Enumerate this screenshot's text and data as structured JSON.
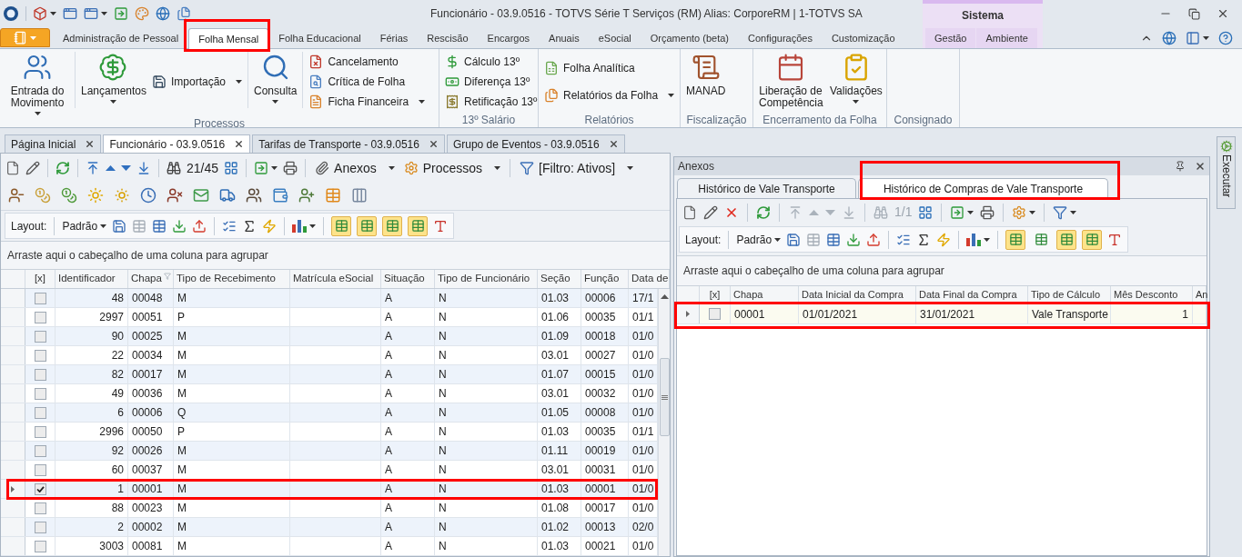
{
  "window": {
    "title": "Funcionário - 03.9.0516 - TOTVS Série T Serviços (RM) Alias: CorporeRM | 1-TOTVS SA"
  },
  "ribbon": {
    "context_group": "Sistema",
    "tabs": [
      {
        "label": "Administração de Pessoal",
        "selected": false,
        "highlighted": false,
        "contextual": false
      },
      {
        "label": "Folha Mensal",
        "selected": true,
        "highlighted": true,
        "contextual": false
      },
      {
        "label": "Folha Educacional",
        "selected": false,
        "highlighted": false,
        "contextual": false
      },
      {
        "label": "Férias",
        "selected": false,
        "highlighted": false,
        "contextual": false
      },
      {
        "label": "Rescisão",
        "selected": false,
        "highlighted": false,
        "contextual": false
      },
      {
        "label": "Encargos",
        "selected": false,
        "highlighted": false,
        "contextual": false
      },
      {
        "label": "Anuais",
        "selected": false,
        "highlighted": false,
        "contextual": false
      },
      {
        "label": "eSocial",
        "selected": false,
        "highlighted": false,
        "contextual": false
      },
      {
        "label": "Orçamento (beta)",
        "selected": false,
        "highlighted": false,
        "contextual": false
      },
      {
        "label": "Configurações",
        "selected": false,
        "highlighted": false,
        "contextual": false
      },
      {
        "label": "Customização",
        "selected": false,
        "highlighted": false,
        "contextual": false
      },
      {
        "label": "Gestão",
        "selected": false,
        "highlighted": false,
        "contextual": true
      },
      {
        "label": "Ambiente",
        "selected": false,
        "highlighted": false,
        "contextual": true
      }
    ],
    "groups": [
      {
        "label": "Processos",
        "items": [
          {
            "kind": "large",
            "label": "Entrada do Movimento",
            "dropdown": true
          },
          {
            "kind": "large",
            "label": "Lançamentos",
            "dropdown": true
          },
          {
            "kind": "stack",
            "buttons": [
              {
                "label": "Importação",
                "dropdown": true
              }
            ]
          },
          {
            "kind": "large",
            "label": "Consulta",
            "dropdown": true
          },
          {
            "kind": "stack",
            "buttons": [
              {
                "label": "Cancelamento",
                "dropdown": false
              },
              {
                "label": "Crítica de Folha",
                "dropdown": false
              },
              {
                "label": "Ficha Financeira",
                "dropdown": true
              }
            ]
          }
        ]
      },
      {
        "label": "13º Salário",
        "items": [
          {
            "kind": "stack",
            "buttons": [
              {
                "label": "Cálculo 13º",
                "dropdown": false
              },
              {
                "label": "Diferença 13º",
                "dropdown": false
              },
              {
                "label": "Retificação 13º",
                "dropdown": false
              }
            ]
          }
        ]
      },
      {
        "label": "Relatórios",
        "items": [
          {
            "kind": "stack",
            "buttons": [
              {
                "label": "Folha Analítica",
                "dropdown": false
              },
              {
                "label": "Relatórios da Folha",
                "dropdown": true
              }
            ]
          }
        ]
      },
      {
        "label": "Fiscalização",
        "items": [
          {
            "kind": "large",
            "label": "MANAD",
            "dropdown": false
          }
        ]
      },
      {
        "label": "Encerramento da Folha",
        "items": [
          {
            "kind": "large",
            "label": "Liberação de Competência",
            "dropdown": false
          },
          {
            "kind": "large",
            "label": "Validações",
            "dropdown": true
          }
        ]
      },
      {
        "label": "Consignado"
      }
    ]
  },
  "document_tabs": [
    {
      "label": "Página Inicial",
      "selected": false
    },
    {
      "label": "Funcionário - 03.9.0516",
      "selected": true
    },
    {
      "label": "Tarifas de Transporte - 03.9.0516",
      "selected": false
    },
    {
      "label": "Grupo de Eventos - 03.9.0516",
      "selected": false
    }
  ],
  "employee_grid": {
    "toolbar": {
      "record_counter": "21/45",
      "navigation_disabled": false,
      "menus": [
        "Anexos",
        "Processos",
        "[Filtro: Ativos]"
      ]
    },
    "layout_bar": {
      "label": "Layout:",
      "preset": "Padrão",
      "toggles": [
        {
          "on": true
        },
        {
          "on": true
        },
        {
          "on": true
        },
        {
          "on": true
        }
      ]
    },
    "group_hint": "Arraste aqui o cabeçalho de uma coluna para agrupar",
    "checkbox_column": "[x]",
    "columns": [
      {
        "label": "Identificador",
        "filtered": false
      },
      {
        "label": "Chapa",
        "filtered": true
      },
      {
        "label": "Tipo de Recebimento",
        "filtered": false
      },
      {
        "label": "Matrícula eSocial",
        "filtered": false
      },
      {
        "label": "Situação",
        "filtered": false
      },
      {
        "label": "Tipo de Funcionário",
        "filtered": false
      },
      {
        "label": "Seção",
        "filtered": false
      },
      {
        "label": "Função",
        "filtered": false
      },
      {
        "label": "Data de",
        "filtered": false
      }
    ],
    "rows": [
      {
        "checked": false,
        "current": false,
        "highlighted": false,
        "cells": [
          "48",
          "00048",
          "M",
          null,
          "A",
          "N",
          "01.03",
          "00006",
          "17/1"
        ]
      },
      {
        "checked": false,
        "current": false,
        "highlighted": false,
        "cells": [
          "2997",
          "00051",
          "P",
          null,
          "A",
          "N",
          "01.06",
          "00035",
          "01/1"
        ]
      },
      {
        "checked": false,
        "current": false,
        "highlighted": false,
        "cells": [
          "90",
          "00025",
          "M",
          null,
          "A",
          "N",
          "01.09",
          "00018",
          "01/0"
        ]
      },
      {
        "checked": false,
        "current": false,
        "highlighted": false,
        "cells": [
          "22",
          "00034",
          "M",
          null,
          "A",
          "N",
          "03.01",
          "00027",
          "01/0"
        ]
      },
      {
        "checked": false,
        "current": false,
        "highlighted": false,
        "cells": [
          "82",
          "00017",
          "M",
          null,
          "A",
          "N",
          "01.07",
          "00015",
          "01/0"
        ]
      },
      {
        "checked": false,
        "current": false,
        "highlighted": false,
        "cells": [
          "49",
          "00036",
          "M",
          null,
          "A",
          "N",
          "03.01",
          "00032",
          "01/0"
        ]
      },
      {
        "checked": false,
        "current": false,
        "highlighted": false,
        "cells": [
          "6",
          "00006",
          "Q",
          null,
          "A",
          "N",
          "01.05",
          "00008",
          "01/0"
        ]
      },
      {
        "checked": false,
        "current": false,
        "highlighted": false,
        "cells": [
          "2996",
          "00050",
          "P",
          null,
          "A",
          "N",
          "01.03",
          "00035",
          "01/1"
        ]
      },
      {
        "checked": false,
        "current": false,
        "highlighted": false,
        "cells": [
          "92",
          "00026",
          "M",
          null,
          "A",
          "N",
          "01.11",
          "00019",
          "01/0"
        ]
      },
      {
        "checked": false,
        "current": false,
        "highlighted": false,
        "cells": [
          "60",
          "00037",
          "M",
          null,
          "A",
          "N",
          "03.01",
          "00031",
          "01/0"
        ]
      },
      {
        "checked": true,
        "current": true,
        "highlighted": true,
        "cells": [
          "1",
          "00001",
          "M",
          null,
          "A",
          "N",
          "01.03",
          "00001",
          "01/0"
        ]
      },
      {
        "checked": false,
        "current": false,
        "highlighted": false,
        "cells": [
          "88",
          "00023",
          "M",
          null,
          "A",
          "N",
          "01.08",
          "00017",
          "01/0"
        ]
      },
      {
        "checked": false,
        "current": false,
        "highlighted": false,
        "cells": [
          "2",
          "00002",
          "M",
          null,
          "A",
          "N",
          "01.02",
          "00013",
          "02/0"
        ]
      },
      {
        "checked": false,
        "current": false,
        "highlighted": false,
        "cells": [
          "3003",
          "00081",
          "M",
          null,
          "A",
          "N",
          "01.03",
          "00021",
          "01/0"
        ]
      }
    ]
  },
  "attachments_panel": {
    "title": "Anexos",
    "tabs": [
      {
        "label": "Histórico de Vale Transporte",
        "selected": false,
        "highlighted": false
      },
      {
        "label": "Histórico de Compras de Vale Transporte",
        "selected": true,
        "highlighted": true
      }
    ],
    "toolbar": {
      "record_counter": "1/1",
      "navigation_disabled": true
    },
    "layout_bar": {
      "label": "Layout:",
      "preset": "Padrão",
      "toggles": [
        {
          "on": true
        },
        {
          "on": false
        },
        {
          "on": true
        },
        {
          "on": true
        }
      ]
    },
    "group_hint": "Arraste aqui o cabeçalho de uma coluna para agrupar",
    "checkbox_column": "[x]",
    "columns": [
      {
        "label": "Chapa"
      },
      {
        "label": "Data Inicial da Compra"
      },
      {
        "label": "Data Final da Compra"
      },
      {
        "label": "Tipo de Cálculo"
      },
      {
        "label": "Mês Desconto"
      },
      {
        "label": "An"
      }
    ],
    "rows": [
      {
        "checked": false,
        "current": true,
        "highlighted": true,
        "cells": [
          "00001",
          "01/01/2021",
          "31/01/2021",
          "Vale Transporte",
          "1",
          null
        ]
      }
    ]
  },
  "side_tab": {
    "label": "Executar"
  }
}
